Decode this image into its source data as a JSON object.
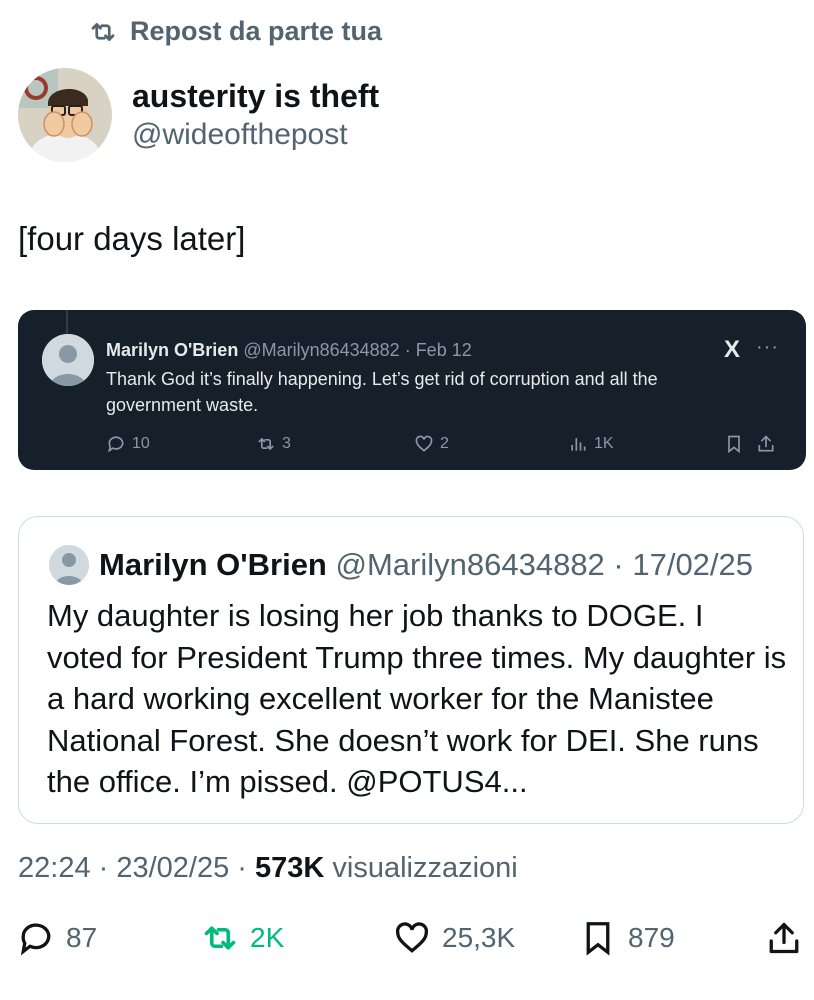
{
  "repost": {
    "label": "Repost da parte tua"
  },
  "author": {
    "name": "austerity is theft",
    "handle": "@wideofthepost"
  },
  "post": {
    "text": "[four days later]"
  },
  "embedded": {
    "name": "Marilyn O'Brien",
    "meta": "@Marilyn86434882 · Feb 12",
    "text": "Thank God it’s finally happening.   Let’s get rid of corruption and all the government waste.",
    "logo": "X",
    "more": "···",
    "replies": "10",
    "reposts": "3",
    "likes": "2",
    "views": "1K"
  },
  "quote": {
    "name": "Marilyn O'Brien",
    "meta": "@Marilyn86434882 · 17/02/25",
    "text": "My daughter is losing her job thanks to DOGE.   I voted for President Trump three times.  My daughter is a hard working excellent worker for the Manistee National Forest.    She doesn’t work for DEI.  She runs the office.   I’m pissed.   @POTUS4..."
  },
  "stamp": {
    "time_date": "22:24 · 23/02/25 · ",
    "views": "573K",
    "views_label": " visualizzazioni"
  },
  "actions": {
    "replies": "87",
    "reposts": "2K",
    "likes": "25,3K",
    "bookmarks": "879"
  },
  "colors": {
    "accent_green": "#00ba7c",
    "muted": "#536471",
    "dark_bg": "#16202a"
  }
}
